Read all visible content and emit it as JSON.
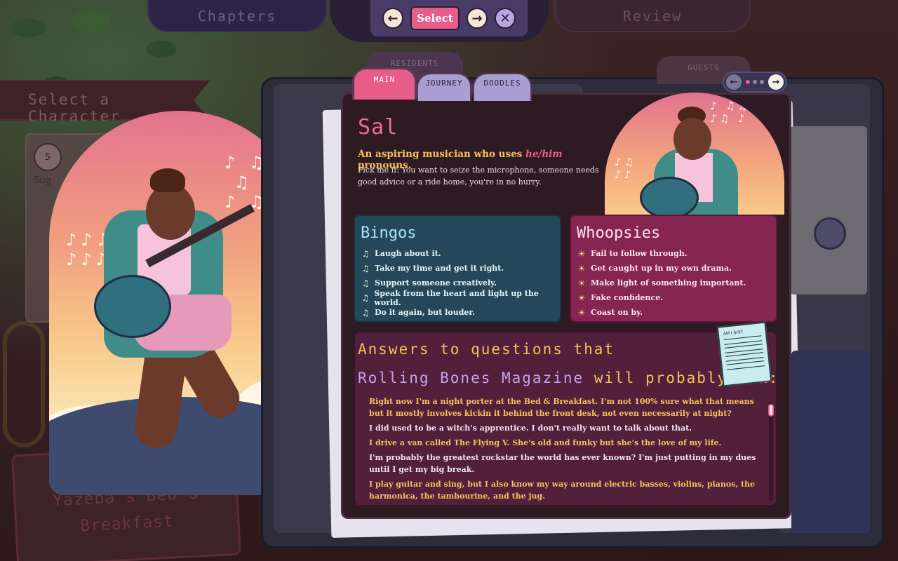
{
  "nav": {
    "chapters_label": "Chapters",
    "review_label": "Review"
  },
  "toolbar": {
    "back_icon": "arrow-left-icon",
    "select_label": "Select",
    "forward_icon": "arrow-right-icon",
    "close_icon": "close-icon"
  },
  "sidebar": {
    "title": "Select a Character",
    "card_number": "5",
    "card_label": "Sug"
  },
  "location": {
    "name": "Yazeba's Bed & Breakfast"
  },
  "tabs": {
    "residents": "RESIDENTS",
    "guests": "GUESTS",
    "main": "MAIN",
    "journey": "JOURNEY",
    "doodles": "DOODLES"
  },
  "pager": {
    "prev_icon": "arrow-left-icon",
    "next_icon": "arrow-right-icon",
    "pages": 3,
    "current": 1
  },
  "character": {
    "name": "Sal",
    "tagline_pre": "An aspiring musician who uses ",
    "pronouns": "he/him",
    "tagline_post": " pronouns.",
    "pick_me": "Pick me if: You want to seize the microphone, someone needs good advice or a ride home, you're in no hurry."
  },
  "bingos": {
    "title": "Bingos",
    "bullet_icon": "music-note-icon",
    "items": [
      "Laugh about it.",
      "Take my time and get it right.",
      "Support someone creatively.",
      "Speak from the heart and light up the world.",
      "Do it again, but louder."
    ]
  },
  "whoopsies": {
    "title": "Whoopsies",
    "bullet_icon": "sun-icon",
    "items": [
      "Fail to follow through.",
      "Get caught up in my own drama.",
      "Make light of something important.",
      "Fake confidence.",
      "Coast on by."
    ]
  },
  "answers": {
    "title_line1": "Answers to questions that",
    "title_magazine": "Rolling Bones Magazine",
    "title_line2_rest": " will probably ask:",
    "sheet_music_title": "AM I SHIT",
    "items": [
      "Right now I'm a night porter at the Bed & Breakfast. I'm not 100% sure what that means but it mostly involves kickin it behind the front desk, not even necessarily at night?",
      "I did used to be a witch's apprentice. I don't really want to talk about that.",
      "I drive a van called The Flying V. She's old and funky but she's the love of my life.",
      "I'm probably the greatest rockstar the world has ever known? I'm just putting in my dues until I get my big break.",
      "I play guitar and sing, but I also know my way around electric basses, violins, pianos, the harmonica, the tambourine, and the jug."
    ]
  },
  "colors": {
    "accent_pink": "#e85c8a",
    "gold": "#f5c35a",
    "bingos_bg": "#24485a",
    "whoopsies_bg": "#852550",
    "answers_bg": "#52203a"
  }
}
